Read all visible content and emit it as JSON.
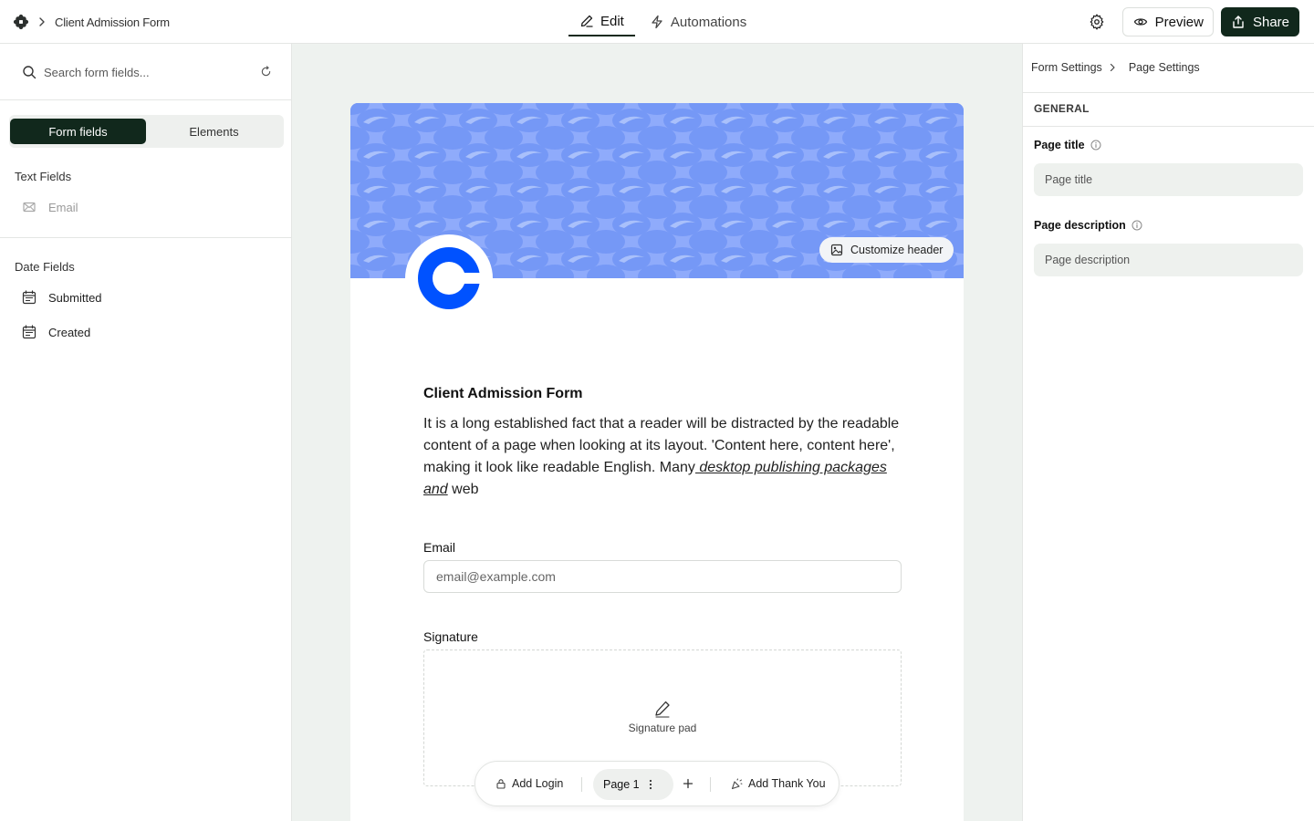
{
  "topbar": {
    "logo_icon": "flower-logo-icon",
    "breadcrumb": "Client Admission Form",
    "tabs": [
      {
        "label": "Edit",
        "icon": "pencil-icon",
        "active": true
      },
      {
        "label": "Automations",
        "icon": "lightning-icon",
        "active": false
      }
    ],
    "preview_label": "Preview",
    "share_label": "Share"
  },
  "left_panel": {
    "search_placeholder": "Search form fields...",
    "toggle": {
      "form_fields": "Form fields",
      "elements": "Elements"
    },
    "text_fields": {
      "title": "Text Fields",
      "items": [
        {
          "label": "Email",
          "icon": "envelope-icon"
        }
      ]
    },
    "date_fields": {
      "title": "Date Fields",
      "items": [
        {
          "label": "Submitted",
          "icon": "calendar-icon"
        },
        {
          "label": "Created",
          "icon": "calendar-icon"
        }
      ]
    }
  },
  "form": {
    "customize_header_label": "Customize header",
    "title": "Client Admission Form",
    "description_plain": "It is a long established fact that a reader will be distracted by the readable content of a page when looking at its layout. 'Content here, content here', making it look like readable English. Many",
    "description_link": " desktop publishing packages and",
    "description_tail": "web",
    "email_label": "Email",
    "email_placeholder": "email@example.com",
    "signature_label": "Signature",
    "signature_pad_text": "Signature pad",
    "banner_color": "#8fabfb",
    "logo_color": "#0052ff"
  },
  "page_bar": {
    "add_login": "Add Login",
    "page_label": "Page 1",
    "add_thank_you": "Add Thank You"
  },
  "right_panel": {
    "breadcrumb_parent": "Form Settings",
    "breadcrumb_current": "Page Settings",
    "section": "GENERAL",
    "page_title_label": "Page title",
    "page_title_placeholder": "Page title",
    "page_description_label": "Page description",
    "page_description_placeholder": "Page description"
  }
}
